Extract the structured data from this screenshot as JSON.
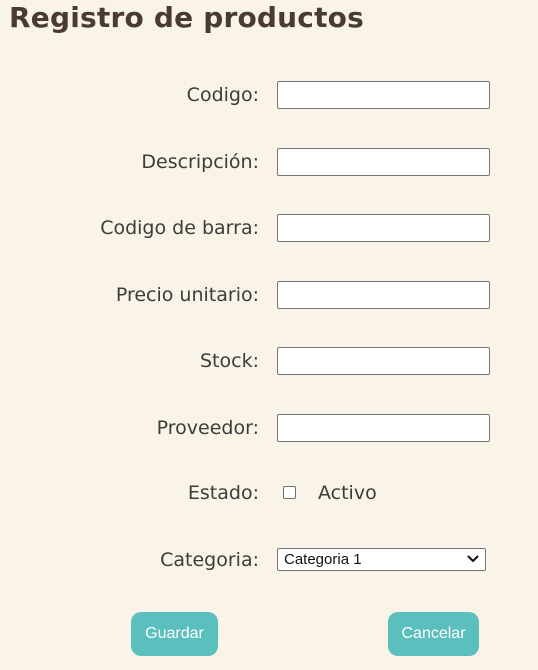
{
  "page": {
    "title": "Registro de productos"
  },
  "form": {
    "codigo_label": "Codigo:",
    "codigo_value": "",
    "descripcion_label": "Descripción:",
    "descripcion_value": "",
    "codigo_barra_label": "Codigo de barra:",
    "codigo_barra_value": "",
    "precio_label": "Precio unitario:",
    "precio_value": "",
    "stock_label": "Stock:",
    "stock_value": "",
    "proveedor_label": "Proveedor:",
    "proveedor_value": "",
    "estado_label": "Estado:",
    "activo_label": "Activo",
    "activo_checked": false,
    "categoria_label": "Categoria:",
    "categoria_selected": "Categoria 1"
  },
  "buttons": {
    "save_label": "Guardar",
    "cancel_label": "Cancelar"
  },
  "colors": {
    "background": "#faf4e8",
    "button": "#5bbfbd",
    "title": "#4a3a33"
  }
}
